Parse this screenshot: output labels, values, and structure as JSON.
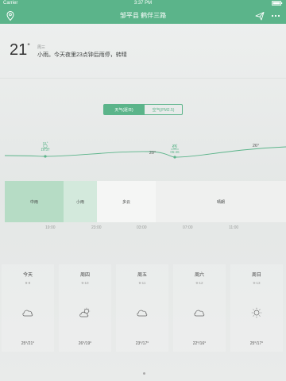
{
  "status_bar": {
    "carrier": "Carrier",
    "time": "3:37 PM"
  },
  "nav": {
    "title": "邹平县 鹤伴三路"
  },
  "current": {
    "temp": "21",
    "degree": "°",
    "label": "周三",
    "description": "小雨。今天夜里23点钟后雨停，转晴"
  },
  "tabs": [
    {
      "label": "天气(逐日)",
      "active": true
    },
    {
      "label": "空气(PM2.5)",
      "active": false
    }
  ],
  "hourly": {
    "point_labels": [
      {
        "temp": "21°",
        "time": "19:37"
      },
      {
        "temp": "20°",
        "time": ""
      },
      {
        "temp": "21°",
        "time": "05:46"
      },
      {
        "temp": "26°",
        "time": ""
      }
    ],
    "bands": [
      "中雨",
      "小雨",
      "多云",
      "晴朗"
    ],
    "band_colors": [
      "#b6dcc5",
      "#d3e9dc",
      "#f5f6f5",
      "#eff0ef"
    ],
    "times": [
      "19:00",
      "23:00",
      "03:00",
      "07:00",
      "11:00"
    ]
  },
  "forecast": [
    {
      "name": "今天",
      "date": "9-9",
      "icon": "cloud-icon",
      "range": "25°/21°"
    },
    {
      "name": "周四",
      "date": "9-10",
      "icon": "partly-cloudy-icon",
      "range": "26°/19°"
    },
    {
      "name": "周五",
      "date": "9-11",
      "icon": "cloud-icon",
      "range": "23°/17°"
    },
    {
      "name": "周六",
      "date": "9-12",
      "icon": "cloud-icon",
      "range": "22°/16°"
    },
    {
      "name": "周日",
      "date": "9-13",
      "icon": "sun-icon",
      "range": "25°/17°"
    }
  ],
  "colors": {
    "accent": "#5bb48a"
  }
}
